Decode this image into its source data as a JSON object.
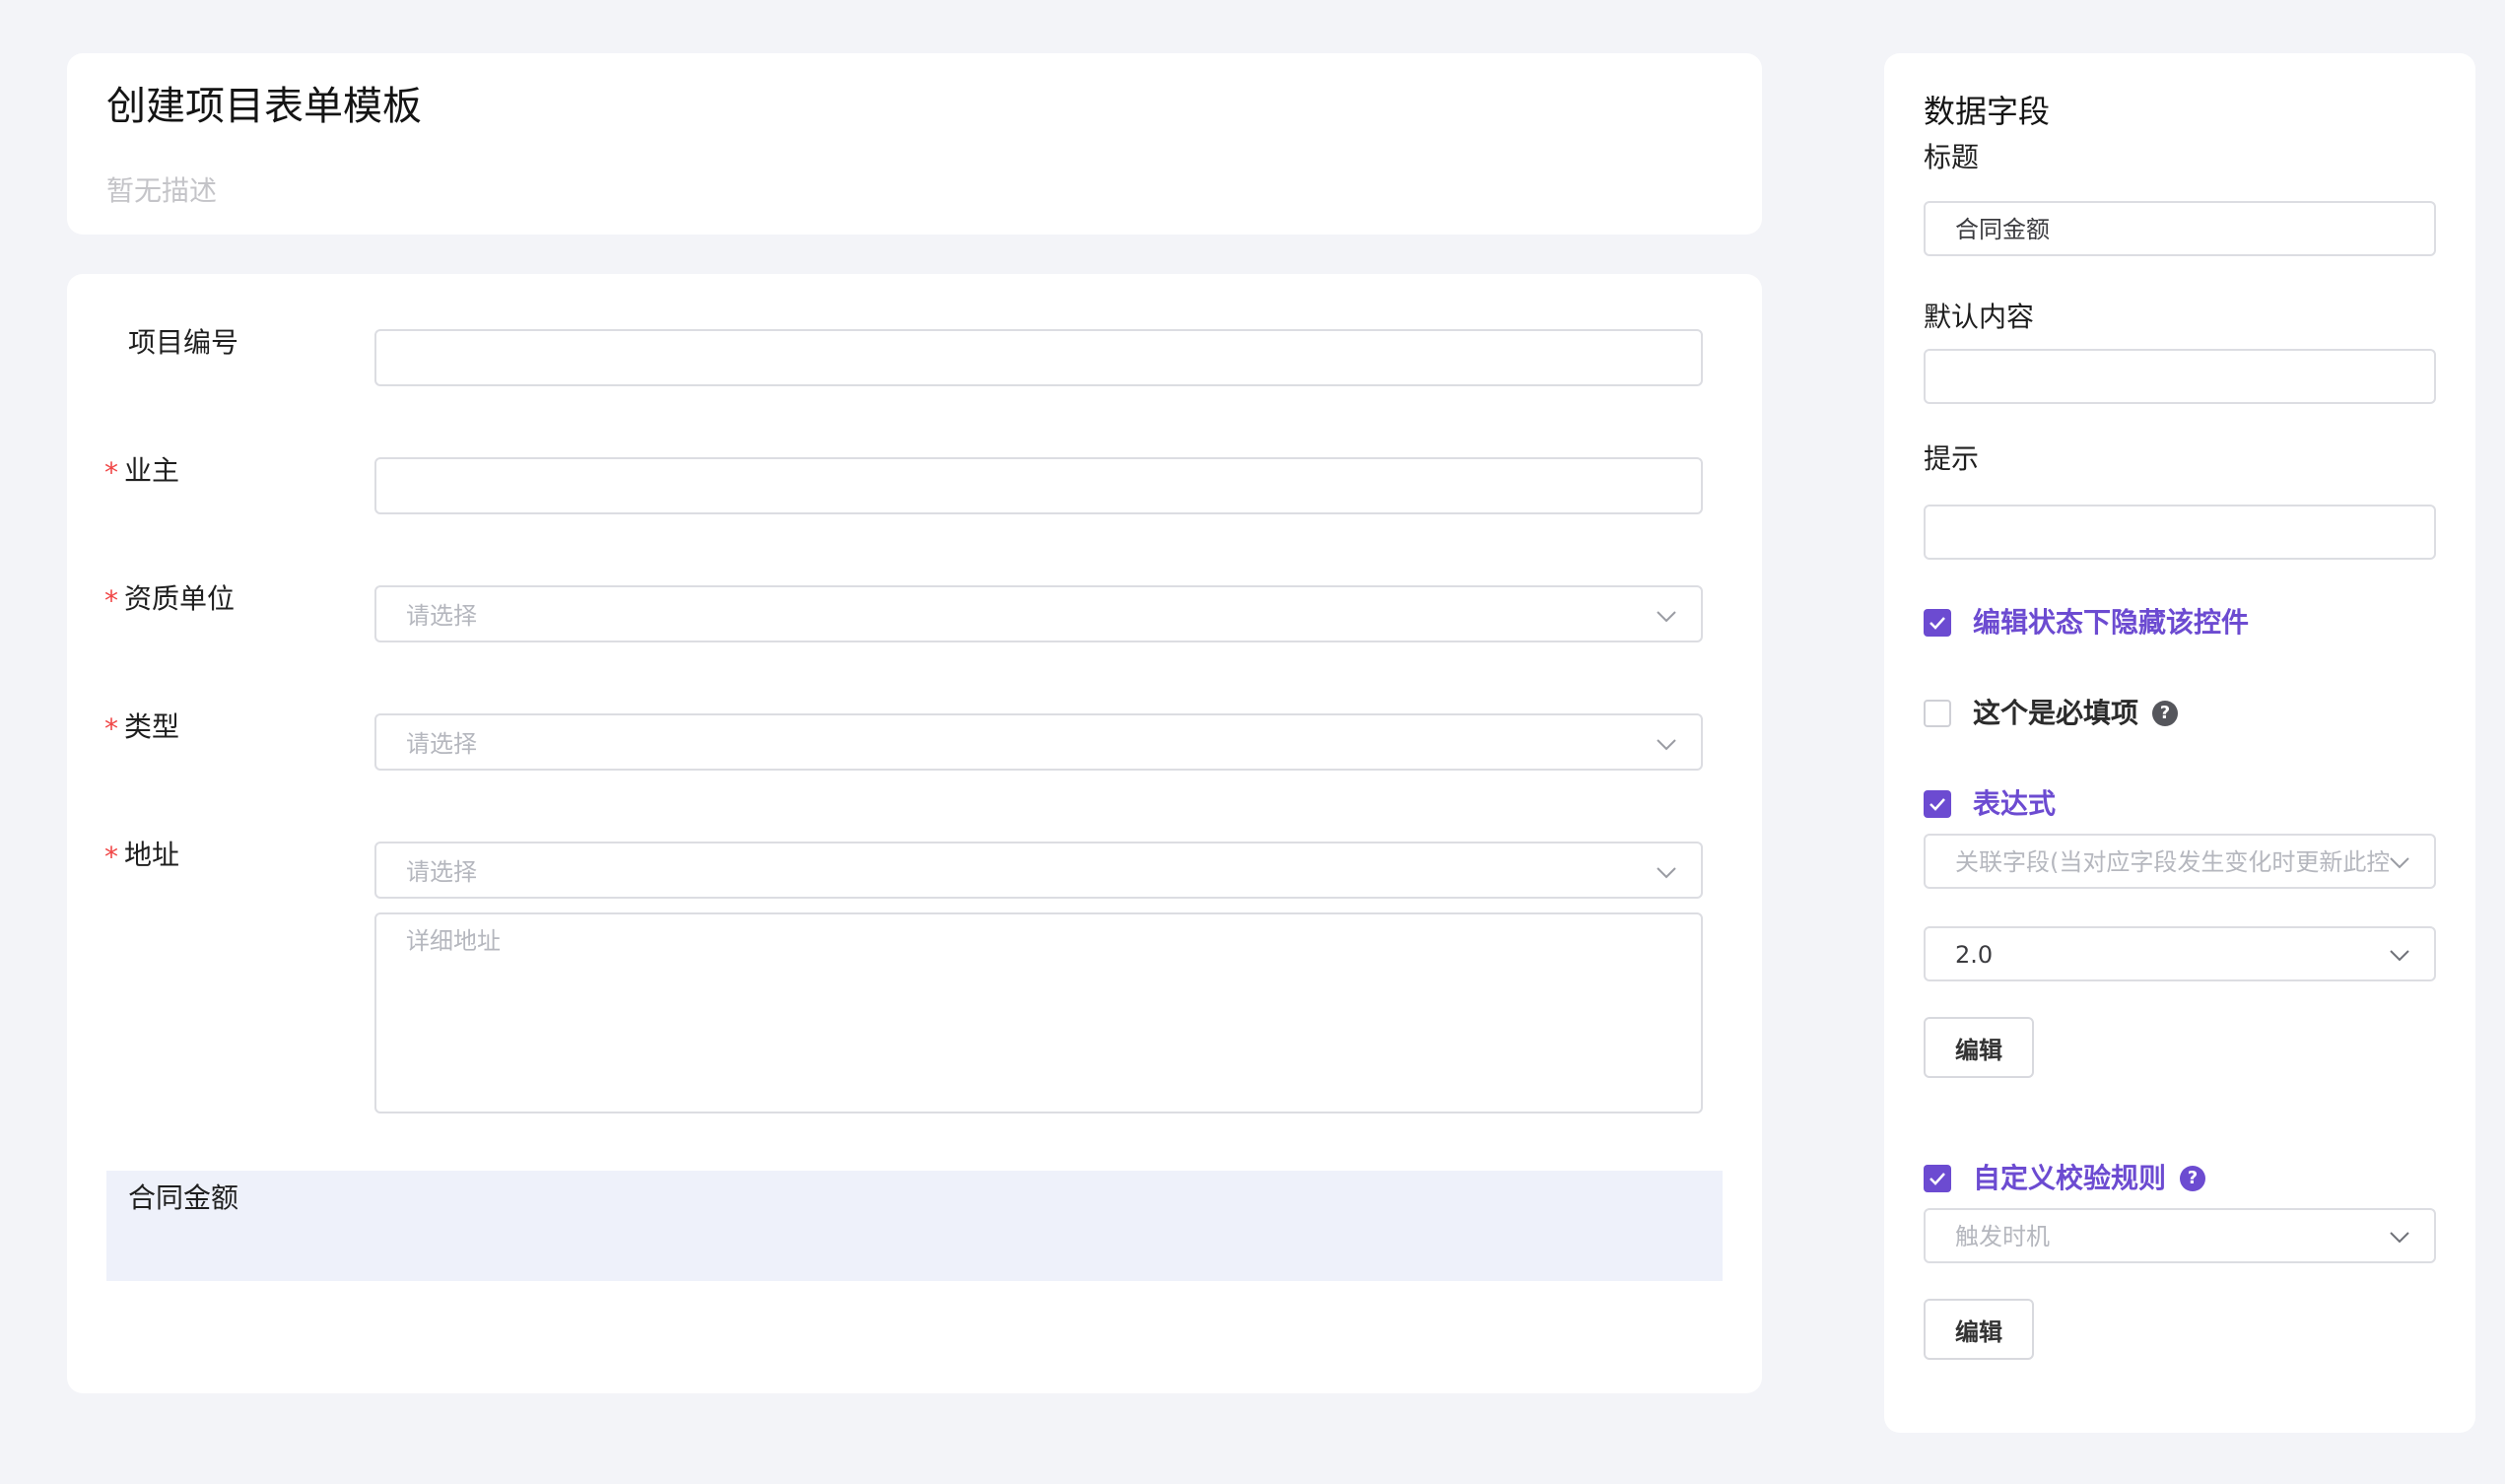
{
  "header": {
    "title": "创建项目表单模板",
    "description": "暂无描述"
  },
  "form": {
    "required_mark": "*",
    "fields": [
      {
        "label": "项目编号",
        "required": false,
        "value": ""
      },
      {
        "label": "业主",
        "required": true,
        "value": ""
      },
      {
        "label": "资质单位",
        "required": true,
        "placeholder": "请选择"
      },
      {
        "label": "类型",
        "required": true,
        "placeholder": "请选择"
      },
      {
        "label": "地址",
        "required": true,
        "placeholder": "请选择",
        "detail_placeholder": "详细地址"
      }
    ],
    "selected_field": {
      "label": "合同金额"
    }
  },
  "side": {
    "title": "数据字段",
    "title_label": "标题",
    "title_value": "合同金额",
    "default_label": "默认内容",
    "default_value": "",
    "hint_label": "提示",
    "hint_value": "",
    "hide_when_editing": {
      "label": "编辑状态下隐藏该控件",
      "checked": true
    },
    "required_item": {
      "label": "这个是必填项",
      "checked": false,
      "help": "?"
    },
    "expression": {
      "label": "表达式",
      "checked": true,
      "related_field_placeholder": "关联字段(当对应字段发生变化时更新此控",
      "version_value": "2.0",
      "edit_label": "编辑"
    },
    "custom_rule": {
      "label": "自定义校验规则",
      "checked": true,
      "help": "?",
      "trigger_placeholder": "触发时机",
      "edit_label": "编辑"
    }
  },
  "colors": {
    "accent": "#6c4bd1",
    "required": "#f04646",
    "background": "#f3f4f8",
    "highlight": "#eef1fa"
  }
}
